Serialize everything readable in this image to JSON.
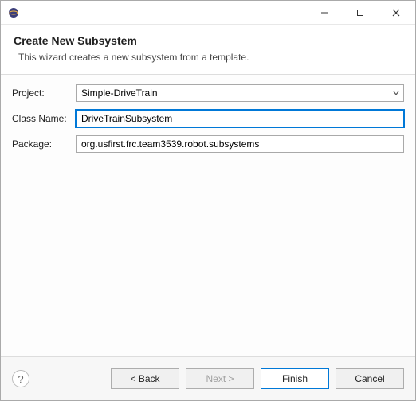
{
  "window": {
    "title": ""
  },
  "header": {
    "title": "Create New Subsystem",
    "description": "This wizard creates a new subsystem from a template."
  },
  "form": {
    "project": {
      "label": "Project:",
      "value": "Simple-DriveTrain",
      "options": [
        "Simple-DriveTrain"
      ]
    },
    "className": {
      "label": "Class Name:",
      "value": "DriveTrainSubsystem"
    },
    "package": {
      "label": "Package:",
      "value": "org.usfirst.frc.team3539.robot.subsystems"
    }
  },
  "buttons": {
    "back": "< Back",
    "next": "Next >",
    "finish": "Finish",
    "cancel": "Cancel"
  }
}
